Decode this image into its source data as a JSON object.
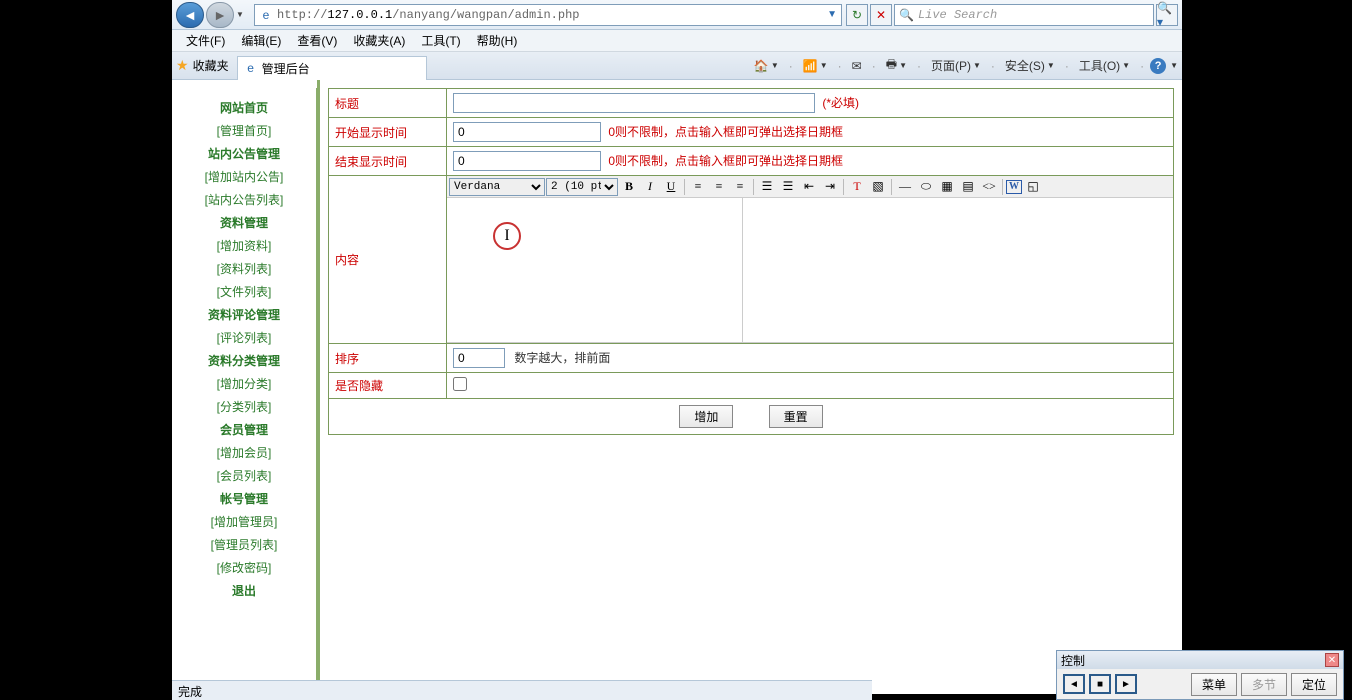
{
  "nav": {
    "url_prefix": "http://",
    "url_host": "127.0.0.1",
    "url_path": "/nanyang/wangpan/admin.php",
    "search_placeholder": "Live Search"
  },
  "menu": {
    "items": [
      "文件(F)",
      "编辑(E)",
      "查看(V)",
      "收藏夹(A)",
      "工具(T)",
      "帮助(H)"
    ]
  },
  "tabs": {
    "fav_label": "收藏夹",
    "active_tab": "管理后台",
    "toolbar": {
      "page": "页面(P)",
      "safety": "安全(S)",
      "tools": "工具(O)"
    }
  },
  "sidebar": [
    {
      "type": "cat",
      "label": "网站首页"
    },
    {
      "type": "link",
      "label": "[管理首页]"
    },
    {
      "type": "cat",
      "label": "站内公告管理"
    },
    {
      "type": "link",
      "label": "[增加站内公告]"
    },
    {
      "type": "link",
      "label": "[站内公告列表]"
    },
    {
      "type": "cat",
      "label": "资料管理"
    },
    {
      "type": "link",
      "label": "[增加资料]"
    },
    {
      "type": "link",
      "label": "[资料列表]"
    },
    {
      "type": "link",
      "label": "[文件列表]"
    },
    {
      "type": "cat",
      "label": "资料评论管理"
    },
    {
      "type": "link",
      "label": "[评论列表]"
    },
    {
      "type": "cat",
      "label": "资料分类管理"
    },
    {
      "type": "link",
      "label": "[增加分类]"
    },
    {
      "type": "link",
      "label": "[分类列表]"
    },
    {
      "type": "cat",
      "label": "会员管理"
    },
    {
      "type": "link",
      "label": "[增加会员]"
    },
    {
      "type": "link",
      "label": "[会员列表]"
    },
    {
      "type": "cat",
      "label": "帐号管理"
    },
    {
      "type": "link",
      "label": "[增加管理员]"
    },
    {
      "type": "link",
      "label": "[管理员列表]"
    },
    {
      "type": "link",
      "label": "[修改密码]"
    },
    {
      "type": "cat",
      "label": "退出"
    }
  ],
  "form": {
    "title_label": "标题",
    "title_value": "",
    "title_req": "(*必填)",
    "start_label": "开始显示时间",
    "start_value": "0",
    "start_hint": "0则不限制，点击输入框即可弹出选择日期框",
    "end_label": "结束显示时间",
    "end_value": "0",
    "end_hint": "0则不限制，点击输入框即可弹出选择日期框",
    "content_label": "内容",
    "sort_label": "排序",
    "sort_value": "0",
    "sort_hint": "数字越大，排前面",
    "hidden_label": "是否隐藏",
    "submit": "增加",
    "reset": "重置"
  },
  "editor": {
    "font": "Verdana",
    "size": "2 (10 pt)"
  },
  "control_panel": {
    "title": "控制",
    "menu": "菜单",
    "multi": "多节",
    "locate": "定位"
  },
  "status": "完成"
}
